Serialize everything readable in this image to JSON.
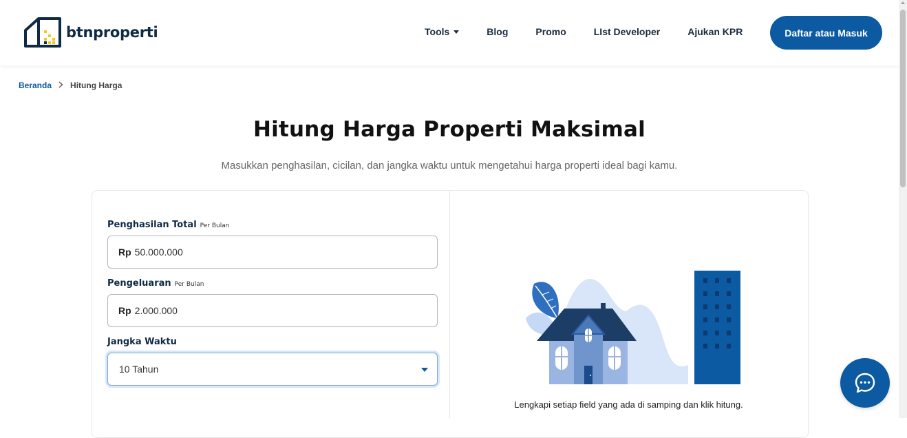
{
  "brand": {
    "name": "btnproperti",
    "accent": "#0b5aa2",
    "dark": "#0f2a44",
    "yellow": "#f2c81c"
  },
  "nav": {
    "items": [
      {
        "label": "Tools",
        "has_dropdown": true
      },
      {
        "label": "Blog"
      },
      {
        "label": "Promo"
      },
      {
        "label": "LIst Developer"
      },
      {
        "label": "Ajukan KPR"
      }
    ],
    "login_label": "Daftar atau Masuk"
  },
  "breadcrumb": {
    "home": "Beranda",
    "current": "Hitung Harga"
  },
  "page": {
    "title": "Hitung Harga Properti Maksimal",
    "subtitle": "Masukkan penghasilan, cicilan, dan jangka waktu untuk mengetahui harga properti ideal bagi kamu."
  },
  "form": {
    "income": {
      "label": "Penghasilan Total",
      "sub": "Per Bulan",
      "prefix": "Rp",
      "value": "50.000.000"
    },
    "expense": {
      "label": "Pengeluaran",
      "sub": "Per Bulan",
      "prefix": "Rp",
      "value": "2.000.000"
    },
    "term": {
      "label": "Jangka Waktu",
      "value": "10 Tahun"
    }
  },
  "result": {
    "caption": "Lengkapi setiap field yang ada di samping dan klik hitung."
  },
  "icons": {
    "chat": "chat-bubble-icon",
    "chevron": "chevron-right-icon",
    "caret": "caret-down-icon"
  }
}
